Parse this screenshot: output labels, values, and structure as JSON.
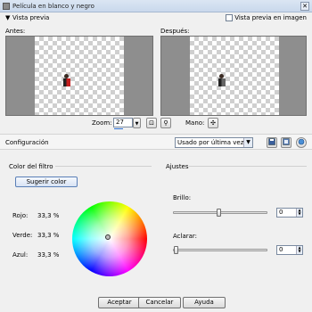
{
  "window": {
    "title": "Película en blanco y negro",
    "close_symbol": "✕"
  },
  "preview": {
    "section_label": "Vista previa",
    "image_preview_label": "Vista previa en imagen",
    "before_label": "Antes:",
    "after_label": "Después:",
    "zoom_label": "Zoom:",
    "zoom_value": "27",
    "hand_label": "Mano:"
  },
  "config": {
    "label": "Configuración",
    "preset_value": "Usado por última vez"
  },
  "filter_color": {
    "title": "Color del filtro",
    "suggest_button": "Sugerir color",
    "red_label": "Rojo:",
    "red_value": "33,3 %",
    "green_label": "Verde:",
    "green_value": "33,3 %",
    "blue_label": "Azul:",
    "blue_value": "33,3 %"
  },
  "adjust": {
    "title": "Ajustes",
    "brightness_label": "Brillo:",
    "brightness_value": "0",
    "clarify_label": "Aclarar:",
    "clarify_value": "0"
  },
  "buttons": {
    "ok": "Aceptar",
    "cancel": "Cancelar",
    "help": "Ayuda"
  },
  "icons": {
    "collapse": "▼",
    "spin_up": "▲",
    "spin_down": "▼",
    "dropdown": "▼",
    "hand": "✣",
    "zoom_fit": "⊡",
    "zoom_magnifier": "⚲"
  }
}
